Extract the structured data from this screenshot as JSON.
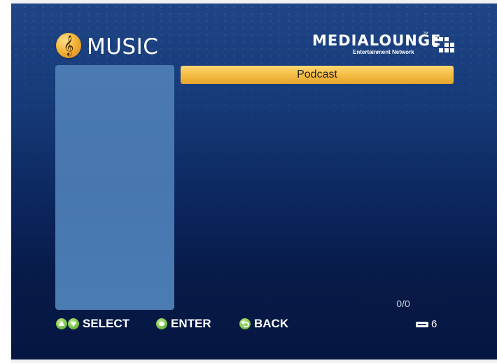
{
  "header": {
    "title": "MUSIC",
    "icon": "music-note-icon",
    "brand": {
      "name": "MEDIALOUNGE",
      "trademark": "™",
      "tagline": "Entertainment Network"
    }
  },
  "menu": {
    "items": [
      {
        "label": "Podcast",
        "selected": true
      }
    ]
  },
  "page_counter": "0/0",
  "controls": {
    "select_label": "SELECT",
    "enter_label": "ENTER",
    "back_label": "BACK"
  },
  "storage": {
    "icon": "storage-device-icon",
    "count": "6"
  },
  "colors": {
    "background_top": "#1f4585",
    "background_bottom": "#061641",
    "selection": "#f4bb41",
    "panel": "#4a7ab1",
    "button_green": "#7cc34c"
  }
}
